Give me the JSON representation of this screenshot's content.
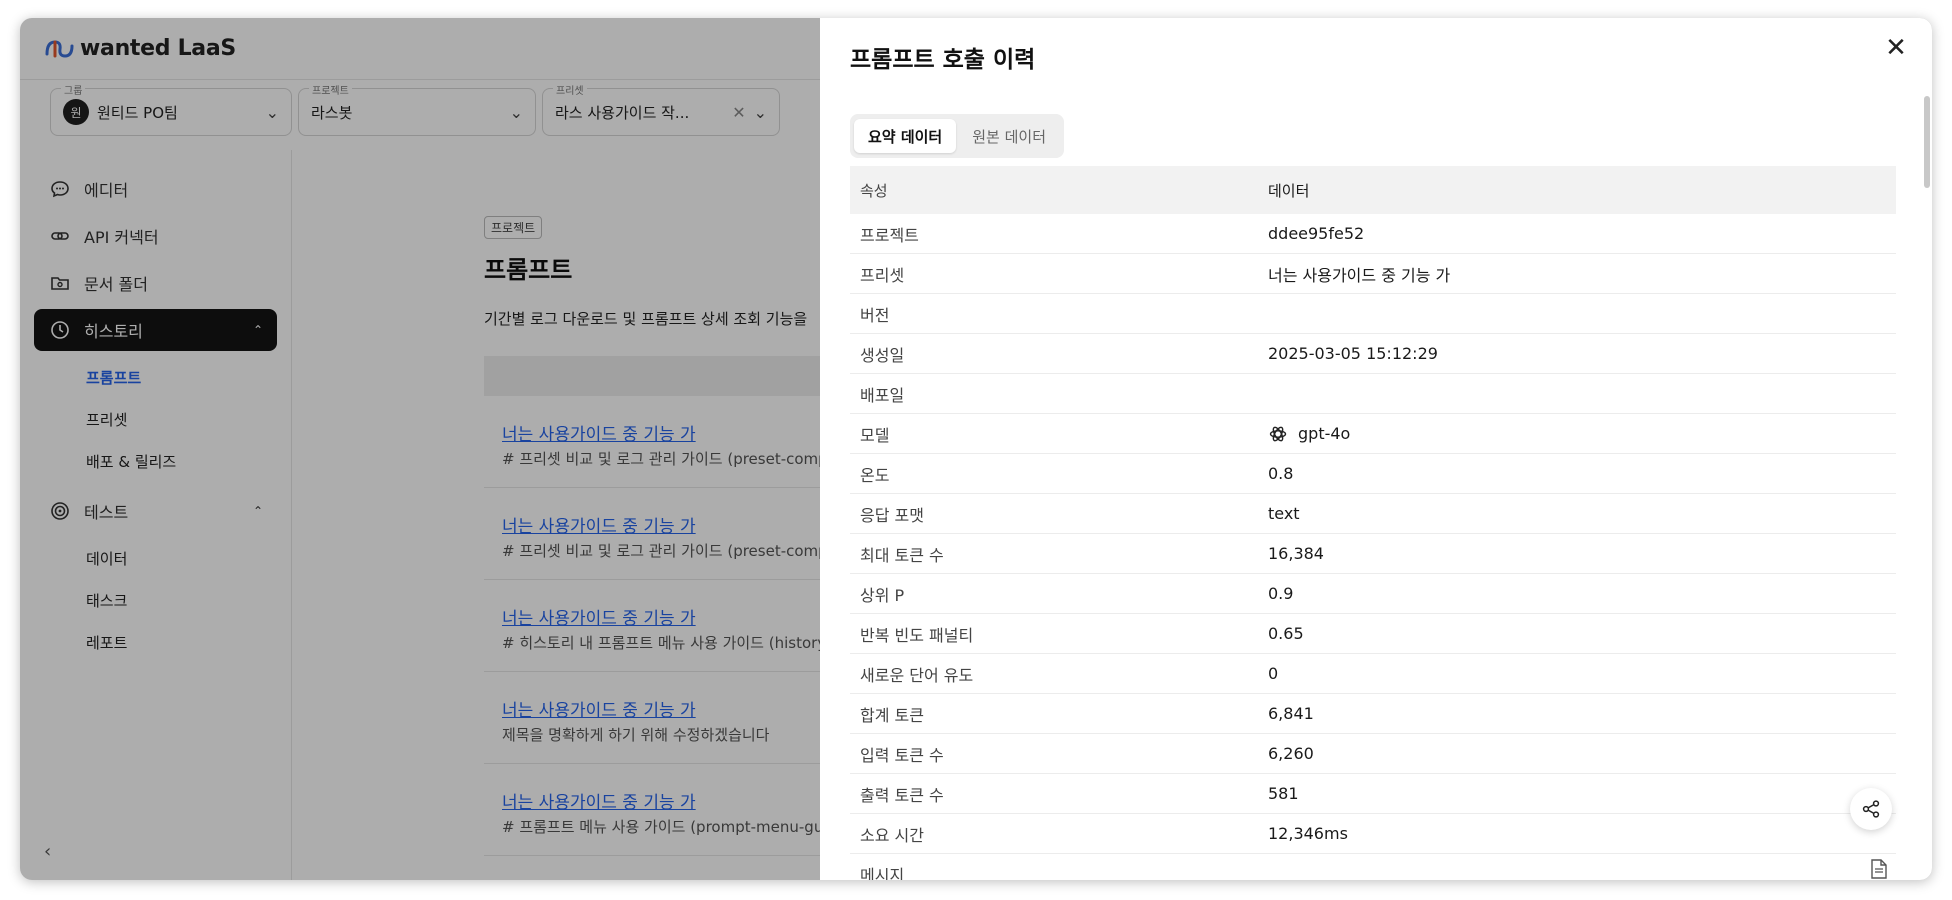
{
  "app": {
    "logo_text": "wanted LaaS"
  },
  "selectors": {
    "group": {
      "legend": "그룹",
      "value": "원티드 PO팀",
      "avatar": "원"
    },
    "project": {
      "legend": "프로젝트",
      "value": "라스봇"
    },
    "preset": {
      "legend": "프리셋",
      "value": "라스 사용가이드 작..."
    }
  },
  "sidebar": {
    "items": [
      {
        "label": "에디터",
        "icon": "chat-icon"
      },
      {
        "label": "API 커넥터",
        "icon": "link-icon"
      },
      {
        "label": "문서 폴더",
        "icon": "folder-icon"
      },
      {
        "label": "히스토리",
        "icon": "clock-icon"
      },
      {
        "label": "테스트",
        "icon": "target-icon"
      }
    ],
    "history_sub": [
      "프롬프트",
      "프리셋",
      "배포 & 릴리즈"
    ],
    "test_sub": [
      "데이터",
      "태스크",
      "레포트"
    ]
  },
  "main": {
    "badge": "프로젝트",
    "title": "프롬프트",
    "description": "기간별 로그 다운로드 및 프롬프트 상세 조회 기능을",
    "rows": [
      {
        "title": "너는 사용가이드 중 기능 가",
        "subtitle": "# 프리셋 비교 및 로그 관리 가이드 (preset-comp"
      },
      {
        "title": "너는 사용가이드 중 기능 가",
        "subtitle": "# 프리셋 비교 및 로그 관리 가이드 (preset-comp"
      },
      {
        "title": "너는 사용가이드 중 기능 가",
        "subtitle": "# 히스토리 내 프롬프트 메뉴 사용 가이드 (history"
      },
      {
        "title": "너는 사용가이드 중 기능 가",
        "subtitle": "제목을 명확하게 하기 위해 수정하겠습니다"
      },
      {
        "title": "너는 사용가이드 중 기능 가",
        "subtitle": "# 프롬프트 메뉴 사용 가이드 (prompt-menu-gu"
      }
    ]
  },
  "drawer": {
    "title": "프롬프트 호출 이력",
    "tabs": [
      "요약 데이터",
      "원본 데이터"
    ],
    "columns": [
      "속성",
      "데이터"
    ],
    "props": [
      {
        "key": "프로젝트",
        "value": "ddee95fe52"
      },
      {
        "key": "프리셋",
        "value": "너는 사용가이드 중 기능 가"
      },
      {
        "key": "버전",
        "value": ""
      },
      {
        "key": "생성일",
        "value": "2025-03-05 15:12:29"
      },
      {
        "key": "배포일",
        "value": ""
      },
      {
        "key": "모델",
        "value": "gpt-4o"
      },
      {
        "key": "온도",
        "value": "0.8"
      },
      {
        "key": "응답 포맷",
        "value": "text"
      },
      {
        "key": "최대 토큰 수",
        "value": "16,384"
      },
      {
        "key": "상위 P",
        "value": "0.9"
      },
      {
        "key": "반복 빈도 패널티",
        "value": "0.65"
      },
      {
        "key": "새로운 단어 유도",
        "value": "0"
      },
      {
        "key": "합계 토큰",
        "value": "6,841"
      },
      {
        "key": "입력 토큰 수",
        "value": "6,260"
      },
      {
        "key": "출력 토큰 수",
        "value": "581"
      },
      {
        "key": "소요 시간",
        "value": "12,346ms"
      },
      {
        "key": "메시지",
        "value": ""
      }
    ]
  }
}
